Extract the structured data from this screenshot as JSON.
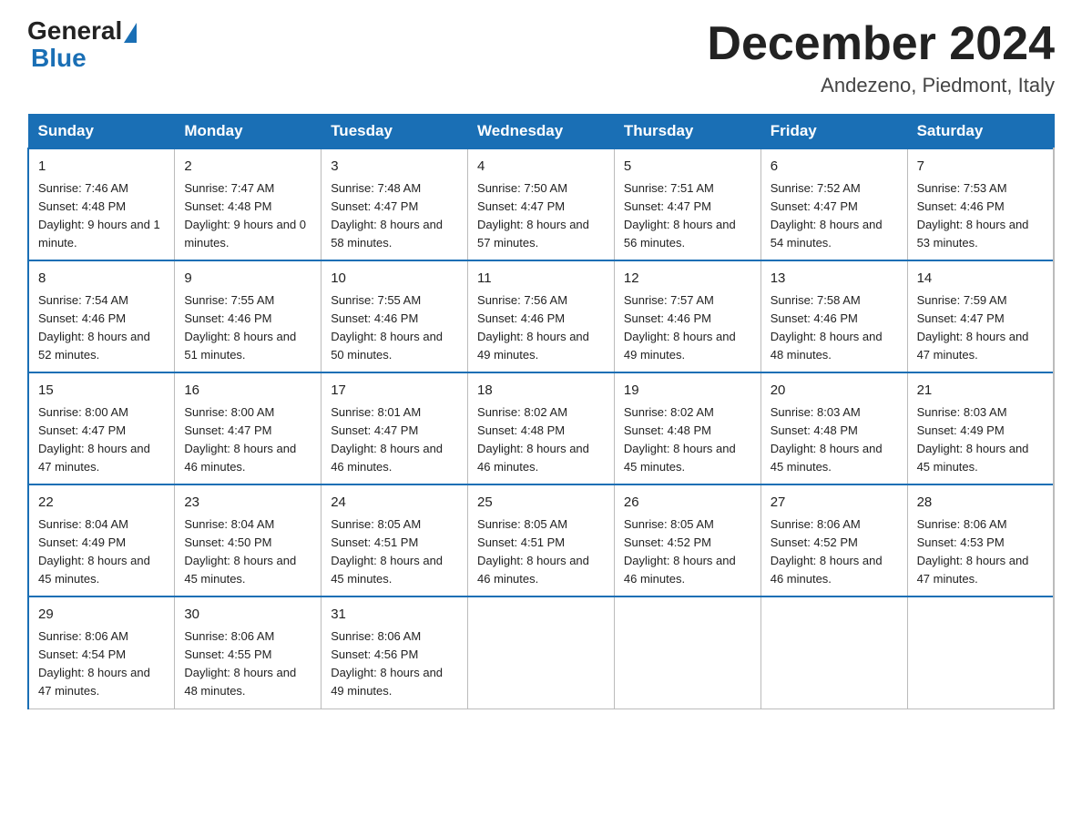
{
  "logo": {
    "general": "General",
    "blue": "Blue"
  },
  "header": {
    "title": "December 2024",
    "location": "Andezeno, Piedmont, Italy"
  },
  "weekdays": [
    "Sunday",
    "Monday",
    "Tuesday",
    "Wednesday",
    "Thursday",
    "Friday",
    "Saturday"
  ],
  "weeks": [
    [
      {
        "day": "1",
        "sunrise": "7:46 AM",
        "sunset": "4:48 PM",
        "daylight": "9 hours and 1 minute."
      },
      {
        "day": "2",
        "sunrise": "7:47 AM",
        "sunset": "4:48 PM",
        "daylight": "9 hours and 0 minutes."
      },
      {
        "day": "3",
        "sunrise": "7:48 AM",
        "sunset": "4:47 PM",
        "daylight": "8 hours and 58 minutes."
      },
      {
        "day": "4",
        "sunrise": "7:50 AM",
        "sunset": "4:47 PM",
        "daylight": "8 hours and 57 minutes."
      },
      {
        "day": "5",
        "sunrise": "7:51 AM",
        "sunset": "4:47 PM",
        "daylight": "8 hours and 56 minutes."
      },
      {
        "day": "6",
        "sunrise": "7:52 AM",
        "sunset": "4:47 PM",
        "daylight": "8 hours and 54 minutes."
      },
      {
        "day": "7",
        "sunrise": "7:53 AM",
        "sunset": "4:46 PM",
        "daylight": "8 hours and 53 minutes."
      }
    ],
    [
      {
        "day": "8",
        "sunrise": "7:54 AM",
        "sunset": "4:46 PM",
        "daylight": "8 hours and 52 minutes."
      },
      {
        "day": "9",
        "sunrise": "7:55 AM",
        "sunset": "4:46 PM",
        "daylight": "8 hours and 51 minutes."
      },
      {
        "day": "10",
        "sunrise": "7:55 AM",
        "sunset": "4:46 PM",
        "daylight": "8 hours and 50 minutes."
      },
      {
        "day": "11",
        "sunrise": "7:56 AM",
        "sunset": "4:46 PM",
        "daylight": "8 hours and 49 minutes."
      },
      {
        "day": "12",
        "sunrise": "7:57 AM",
        "sunset": "4:46 PM",
        "daylight": "8 hours and 49 minutes."
      },
      {
        "day": "13",
        "sunrise": "7:58 AM",
        "sunset": "4:46 PM",
        "daylight": "8 hours and 48 minutes."
      },
      {
        "day": "14",
        "sunrise": "7:59 AM",
        "sunset": "4:47 PM",
        "daylight": "8 hours and 47 minutes."
      }
    ],
    [
      {
        "day": "15",
        "sunrise": "8:00 AM",
        "sunset": "4:47 PM",
        "daylight": "8 hours and 47 minutes."
      },
      {
        "day": "16",
        "sunrise": "8:00 AM",
        "sunset": "4:47 PM",
        "daylight": "8 hours and 46 minutes."
      },
      {
        "day": "17",
        "sunrise": "8:01 AM",
        "sunset": "4:47 PM",
        "daylight": "8 hours and 46 minutes."
      },
      {
        "day": "18",
        "sunrise": "8:02 AM",
        "sunset": "4:48 PM",
        "daylight": "8 hours and 46 minutes."
      },
      {
        "day": "19",
        "sunrise": "8:02 AM",
        "sunset": "4:48 PM",
        "daylight": "8 hours and 45 minutes."
      },
      {
        "day": "20",
        "sunrise": "8:03 AM",
        "sunset": "4:48 PM",
        "daylight": "8 hours and 45 minutes."
      },
      {
        "day": "21",
        "sunrise": "8:03 AM",
        "sunset": "4:49 PM",
        "daylight": "8 hours and 45 minutes."
      }
    ],
    [
      {
        "day": "22",
        "sunrise": "8:04 AM",
        "sunset": "4:49 PM",
        "daylight": "8 hours and 45 minutes."
      },
      {
        "day": "23",
        "sunrise": "8:04 AM",
        "sunset": "4:50 PM",
        "daylight": "8 hours and 45 minutes."
      },
      {
        "day": "24",
        "sunrise": "8:05 AM",
        "sunset": "4:51 PM",
        "daylight": "8 hours and 45 minutes."
      },
      {
        "day": "25",
        "sunrise": "8:05 AM",
        "sunset": "4:51 PM",
        "daylight": "8 hours and 46 minutes."
      },
      {
        "day": "26",
        "sunrise": "8:05 AM",
        "sunset": "4:52 PM",
        "daylight": "8 hours and 46 minutes."
      },
      {
        "day": "27",
        "sunrise": "8:06 AM",
        "sunset": "4:52 PM",
        "daylight": "8 hours and 46 minutes."
      },
      {
        "day": "28",
        "sunrise": "8:06 AM",
        "sunset": "4:53 PM",
        "daylight": "8 hours and 47 minutes."
      }
    ],
    [
      {
        "day": "29",
        "sunrise": "8:06 AM",
        "sunset": "4:54 PM",
        "daylight": "8 hours and 47 minutes."
      },
      {
        "day": "30",
        "sunrise": "8:06 AM",
        "sunset": "4:55 PM",
        "daylight": "8 hours and 48 minutes."
      },
      {
        "day": "31",
        "sunrise": "8:06 AM",
        "sunset": "4:56 PM",
        "daylight": "8 hours and 49 minutes."
      },
      null,
      null,
      null,
      null
    ]
  ]
}
